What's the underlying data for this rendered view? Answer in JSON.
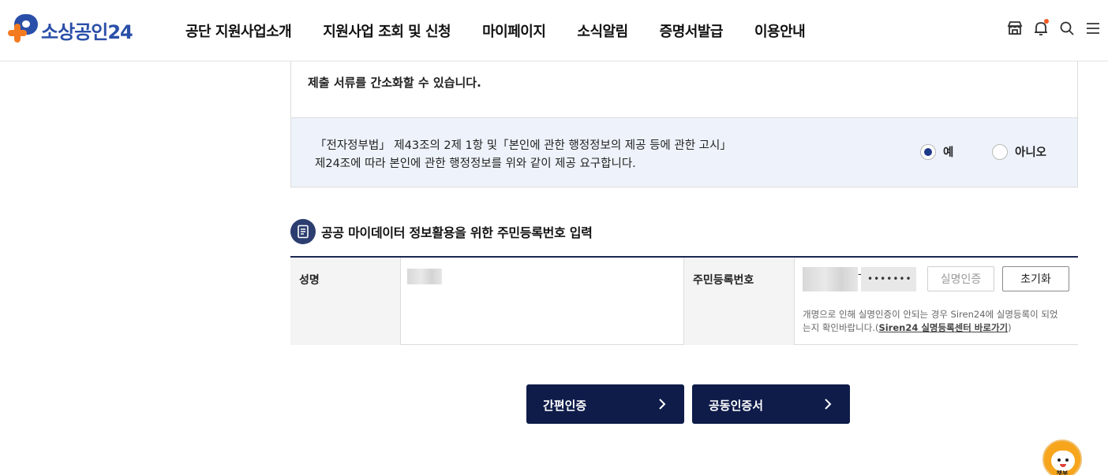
{
  "header": {
    "logo_text": "소상공인24",
    "nav": [
      "공단 지원사업소개",
      "지원사업 조회 및 신청",
      "마이페이지",
      "소식알림",
      "증명서발급",
      "이용안내"
    ],
    "icons": [
      "store-icon",
      "bell-icon",
      "search-icon",
      "menu-icon"
    ],
    "colors": {
      "brand_blue": "#2a4fa8",
      "brand_orange": "#f47b20",
      "notification_dot": "#f25a22"
    }
  },
  "main": {
    "notice": "제출 서류를 간소화할 수 있습니다.",
    "consent": {
      "line1": "「전자정부법」 제43조의 2제 1항 및「본인에 관한 행정정보의 제공 등에 관한 고시」",
      "line2": "제24조에 따라 본인에 관한 행정정보를 위와 같이 제공 요구합니다.",
      "options": [
        {
          "label": "예",
          "selected": true
        },
        {
          "label": "아니오",
          "selected": false
        }
      ]
    },
    "section_title": "공공 마이데이터 정보활용을 위한 주민등록번호 입력",
    "form": {
      "name_label": "성명",
      "rrn_label": "주민등록번호",
      "rrn_separator": "-",
      "rrn_back_masked": "•••••••",
      "verify_button": "실명인증",
      "reset_button": "초기화",
      "note_prefix": "개명으로 인해 실명인증이 안되는 경우 Siren24에 실명등록이 되었는지 확인바랍니다.(",
      "note_link": "Siren24 실명등록센터 바로가기",
      "note_suffix": ")"
    },
    "actions": {
      "simple_auth": "간편인증",
      "joint_cert": "공동인증서"
    },
    "colors": {
      "primary_navy": "#0f1c4a",
      "consent_bg": "#eef3fb"
    }
  },
  "chatbot": {
    "caption": "챗봇"
  }
}
